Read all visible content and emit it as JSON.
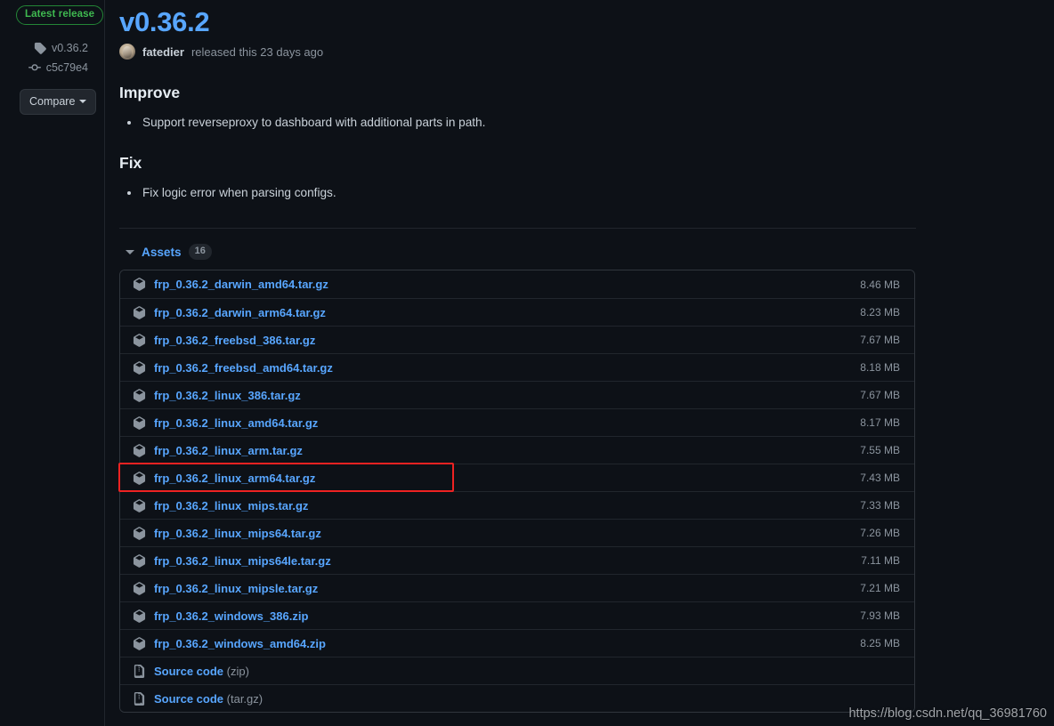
{
  "sidebar": {
    "latest_badge": "Latest release",
    "tag": "v0.36.2",
    "commit": "c5c79e4",
    "compare_label": "Compare",
    "tag_icon": "tag-icon",
    "commit_icon": "git-commit-icon"
  },
  "release": {
    "title": "v0.36.2",
    "author": "fatedier",
    "byline_rest": "released this 23 days ago",
    "sections": [
      {
        "heading": "Improve",
        "items": [
          "Support reverseproxy to dashboard with additional parts in path."
        ]
      },
      {
        "heading": "Fix",
        "items": [
          "Fix logic error when parsing configs."
        ]
      }
    ]
  },
  "assets": {
    "label": "Assets",
    "count": "16",
    "rows": [
      {
        "name": "frp_0.36.2_darwin_amd64.tar.gz",
        "suffix": "",
        "size": "8.46 MB",
        "icon": "package-icon"
      },
      {
        "name": "frp_0.36.2_darwin_arm64.tar.gz",
        "suffix": "",
        "size": "8.23 MB",
        "icon": "package-icon"
      },
      {
        "name": "frp_0.36.2_freebsd_386.tar.gz",
        "suffix": "",
        "size": "7.67 MB",
        "icon": "package-icon"
      },
      {
        "name": "frp_0.36.2_freebsd_amd64.tar.gz",
        "suffix": "",
        "size": "8.18 MB",
        "icon": "package-icon"
      },
      {
        "name": "frp_0.36.2_linux_386.tar.gz",
        "suffix": "",
        "size": "7.67 MB",
        "icon": "package-icon"
      },
      {
        "name": "frp_0.36.2_linux_amd64.tar.gz",
        "suffix": "",
        "size": "8.17 MB",
        "icon": "package-icon"
      },
      {
        "name": "frp_0.36.2_linux_arm.tar.gz",
        "suffix": "",
        "size": "7.55 MB",
        "icon": "package-icon"
      },
      {
        "name": "frp_0.36.2_linux_arm64.tar.gz",
        "suffix": "",
        "size": "7.43 MB",
        "icon": "package-icon"
      },
      {
        "name": "frp_0.36.2_linux_mips.tar.gz",
        "suffix": "",
        "size": "7.33 MB",
        "icon": "package-icon"
      },
      {
        "name": "frp_0.36.2_linux_mips64.tar.gz",
        "suffix": "",
        "size": "7.26 MB",
        "icon": "package-icon"
      },
      {
        "name": "frp_0.36.2_linux_mips64le.tar.gz",
        "suffix": "",
        "size": "7.11 MB",
        "icon": "package-icon"
      },
      {
        "name": "frp_0.36.2_linux_mipsle.tar.gz",
        "suffix": "",
        "size": "7.21 MB",
        "icon": "package-icon"
      },
      {
        "name": "frp_0.36.2_windows_386.zip",
        "suffix": "",
        "size": "7.93 MB",
        "icon": "package-icon"
      },
      {
        "name": "frp_0.36.2_windows_amd64.zip",
        "suffix": "",
        "size": "8.25 MB",
        "icon": "package-icon"
      },
      {
        "name": "Source code",
        "suffix": " (zip)",
        "size": "",
        "icon": "file-zip-icon"
      },
      {
        "name": "Source code",
        "suffix": " (tar.gz)",
        "size": "",
        "icon": "file-zip-icon"
      }
    ]
  },
  "annotation": {
    "highlighted_asset": "frp_0.36.2_linux_arm64.tar.gz",
    "color": "#ee2222"
  },
  "watermark": {
    "text": "https://blog.csdn.net/qq_36981760"
  },
  "colors": {
    "background": "#0d1117",
    "link": "#58a6ff",
    "muted": "#8b949e",
    "text": "#c9d1d9",
    "border": "#30363d",
    "badge_green": "#3fb950"
  }
}
